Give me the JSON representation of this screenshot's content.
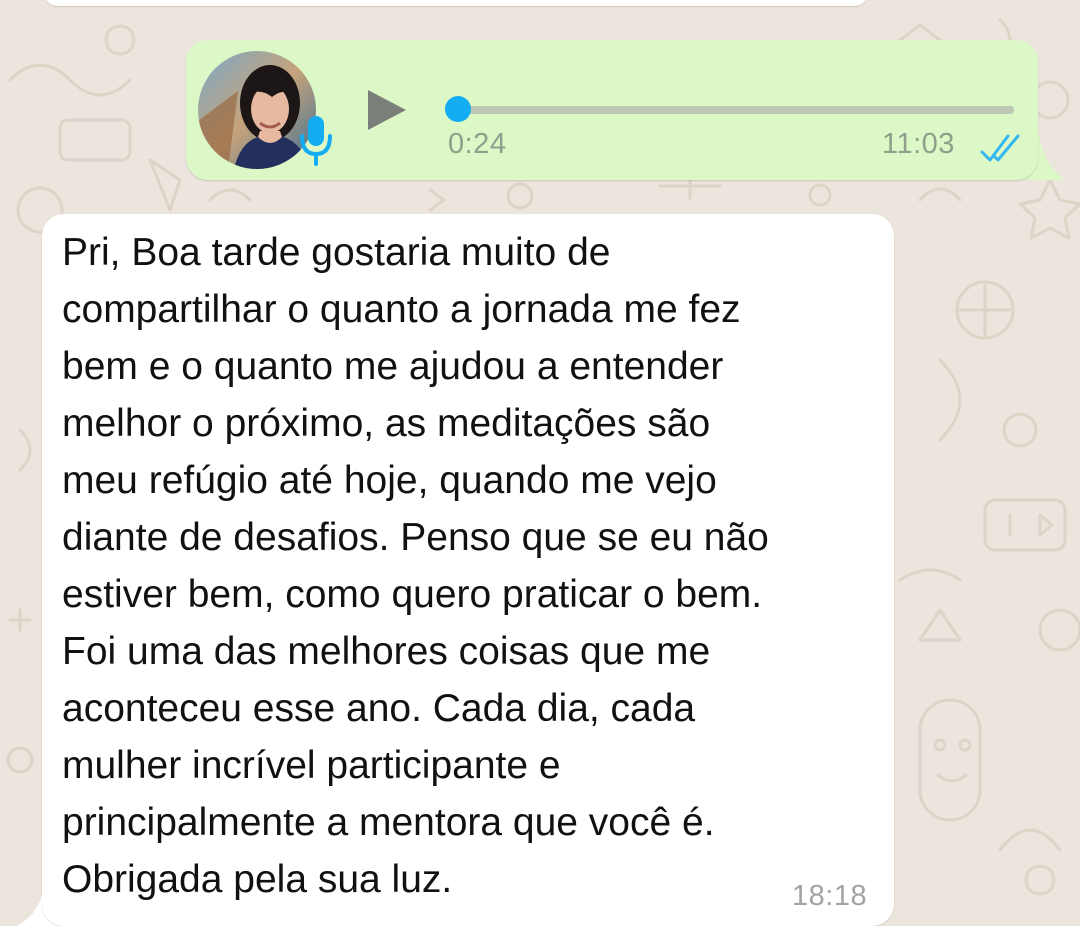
{
  "audio_message": {
    "duration": "0:24",
    "time": "11:03",
    "progress": 0.0,
    "status": "read",
    "accent_color": "#15adf2",
    "bubble_color": "#dcf8c6"
  },
  "text_message": {
    "lines": [
      "Pri, Boa tarde gostaria muito de",
      "compartilhar o quanto a jornada me fez",
      "bem e o quanto me ajudou a entender",
      "melhor o próximo, as meditações são",
      "meu refúgio até hoje, quando me vejo",
      "diante de desafios. Penso que se eu não",
      "estiver bem, como quero praticar o bem.",
      "Foi uma das melhores coisas que me",
      "aconteceu esse ano. Cada dia, cada",
      "mulher incrível participante e",
      "principalmente a mentora que você é.",
      "Obrigada pela sua luz."
    ],
    "time": "18:18",
    "bubble_color": "#ffffff"
  },
  "icons": {
    "play": "play-icon",
    "mic": "microphone-icon",
    "ticks": "double-check-icon"
  },
  "background_color": "#ece5dd"
}
